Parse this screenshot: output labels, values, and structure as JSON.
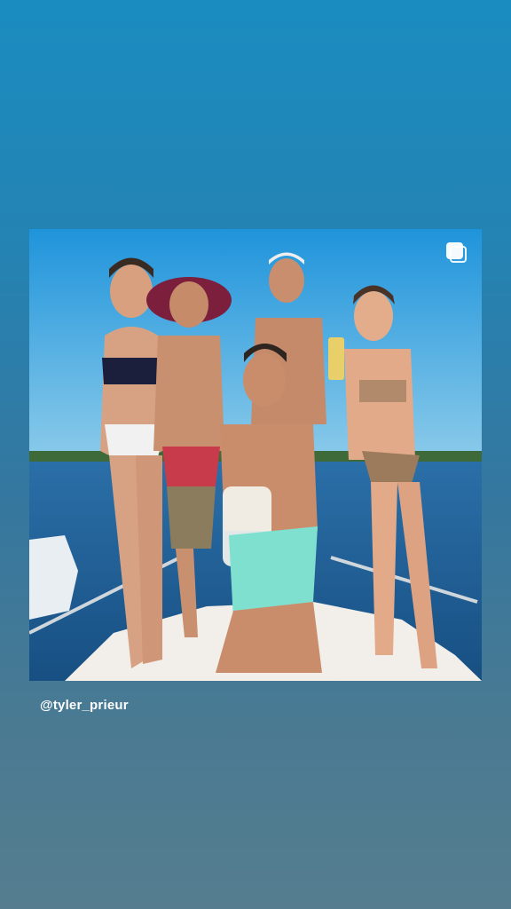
{
  "post": {
    "mention": "@tyler_prieur",
    "carousel_icon": "multiple-photos-icon"
  },
  "colors": {
    "sky": "#2f9bd6",
    "water": "#1c5f9a",
    "boat_deck": "#f2efea",
    "shorts": "#7fe0d0",
    "text": "#ffffff"
  }
}
